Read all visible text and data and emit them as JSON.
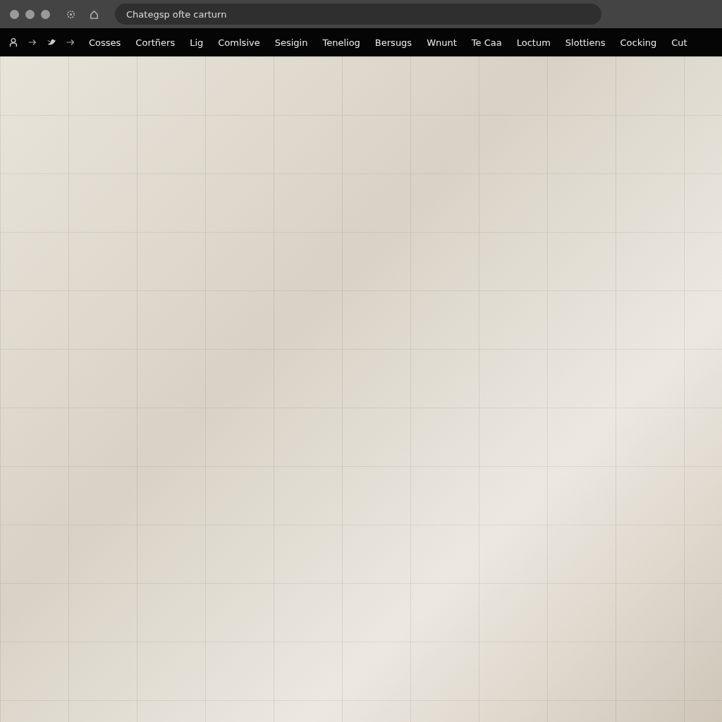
{
  "browser": {
    "address": "Chategsp ofte carturn"
  },
  "nav": {
    "items": [
      {
        "label": "Cosses"
      },
      {
        "label": "Cortñers"
      },
      {
        "label": "Lig"
      },
      {
        "label": "Comlsive"
      },
      {
        "label": "Sesigin"
      },
      {
        "label": "Teneliog"
      },
      {
        "label": "Bersugs"
      },
      {
        "label": "Wnunt"
      },
      {
        "label": "Te Caa"
      },
      {
        "label": "Loctum"
      },
      {
        "label": "Slottiens"
      },
      {
        "label": "Cocking"
      },
      {
        "label": "Cut"
      }
    ]
  }
}
